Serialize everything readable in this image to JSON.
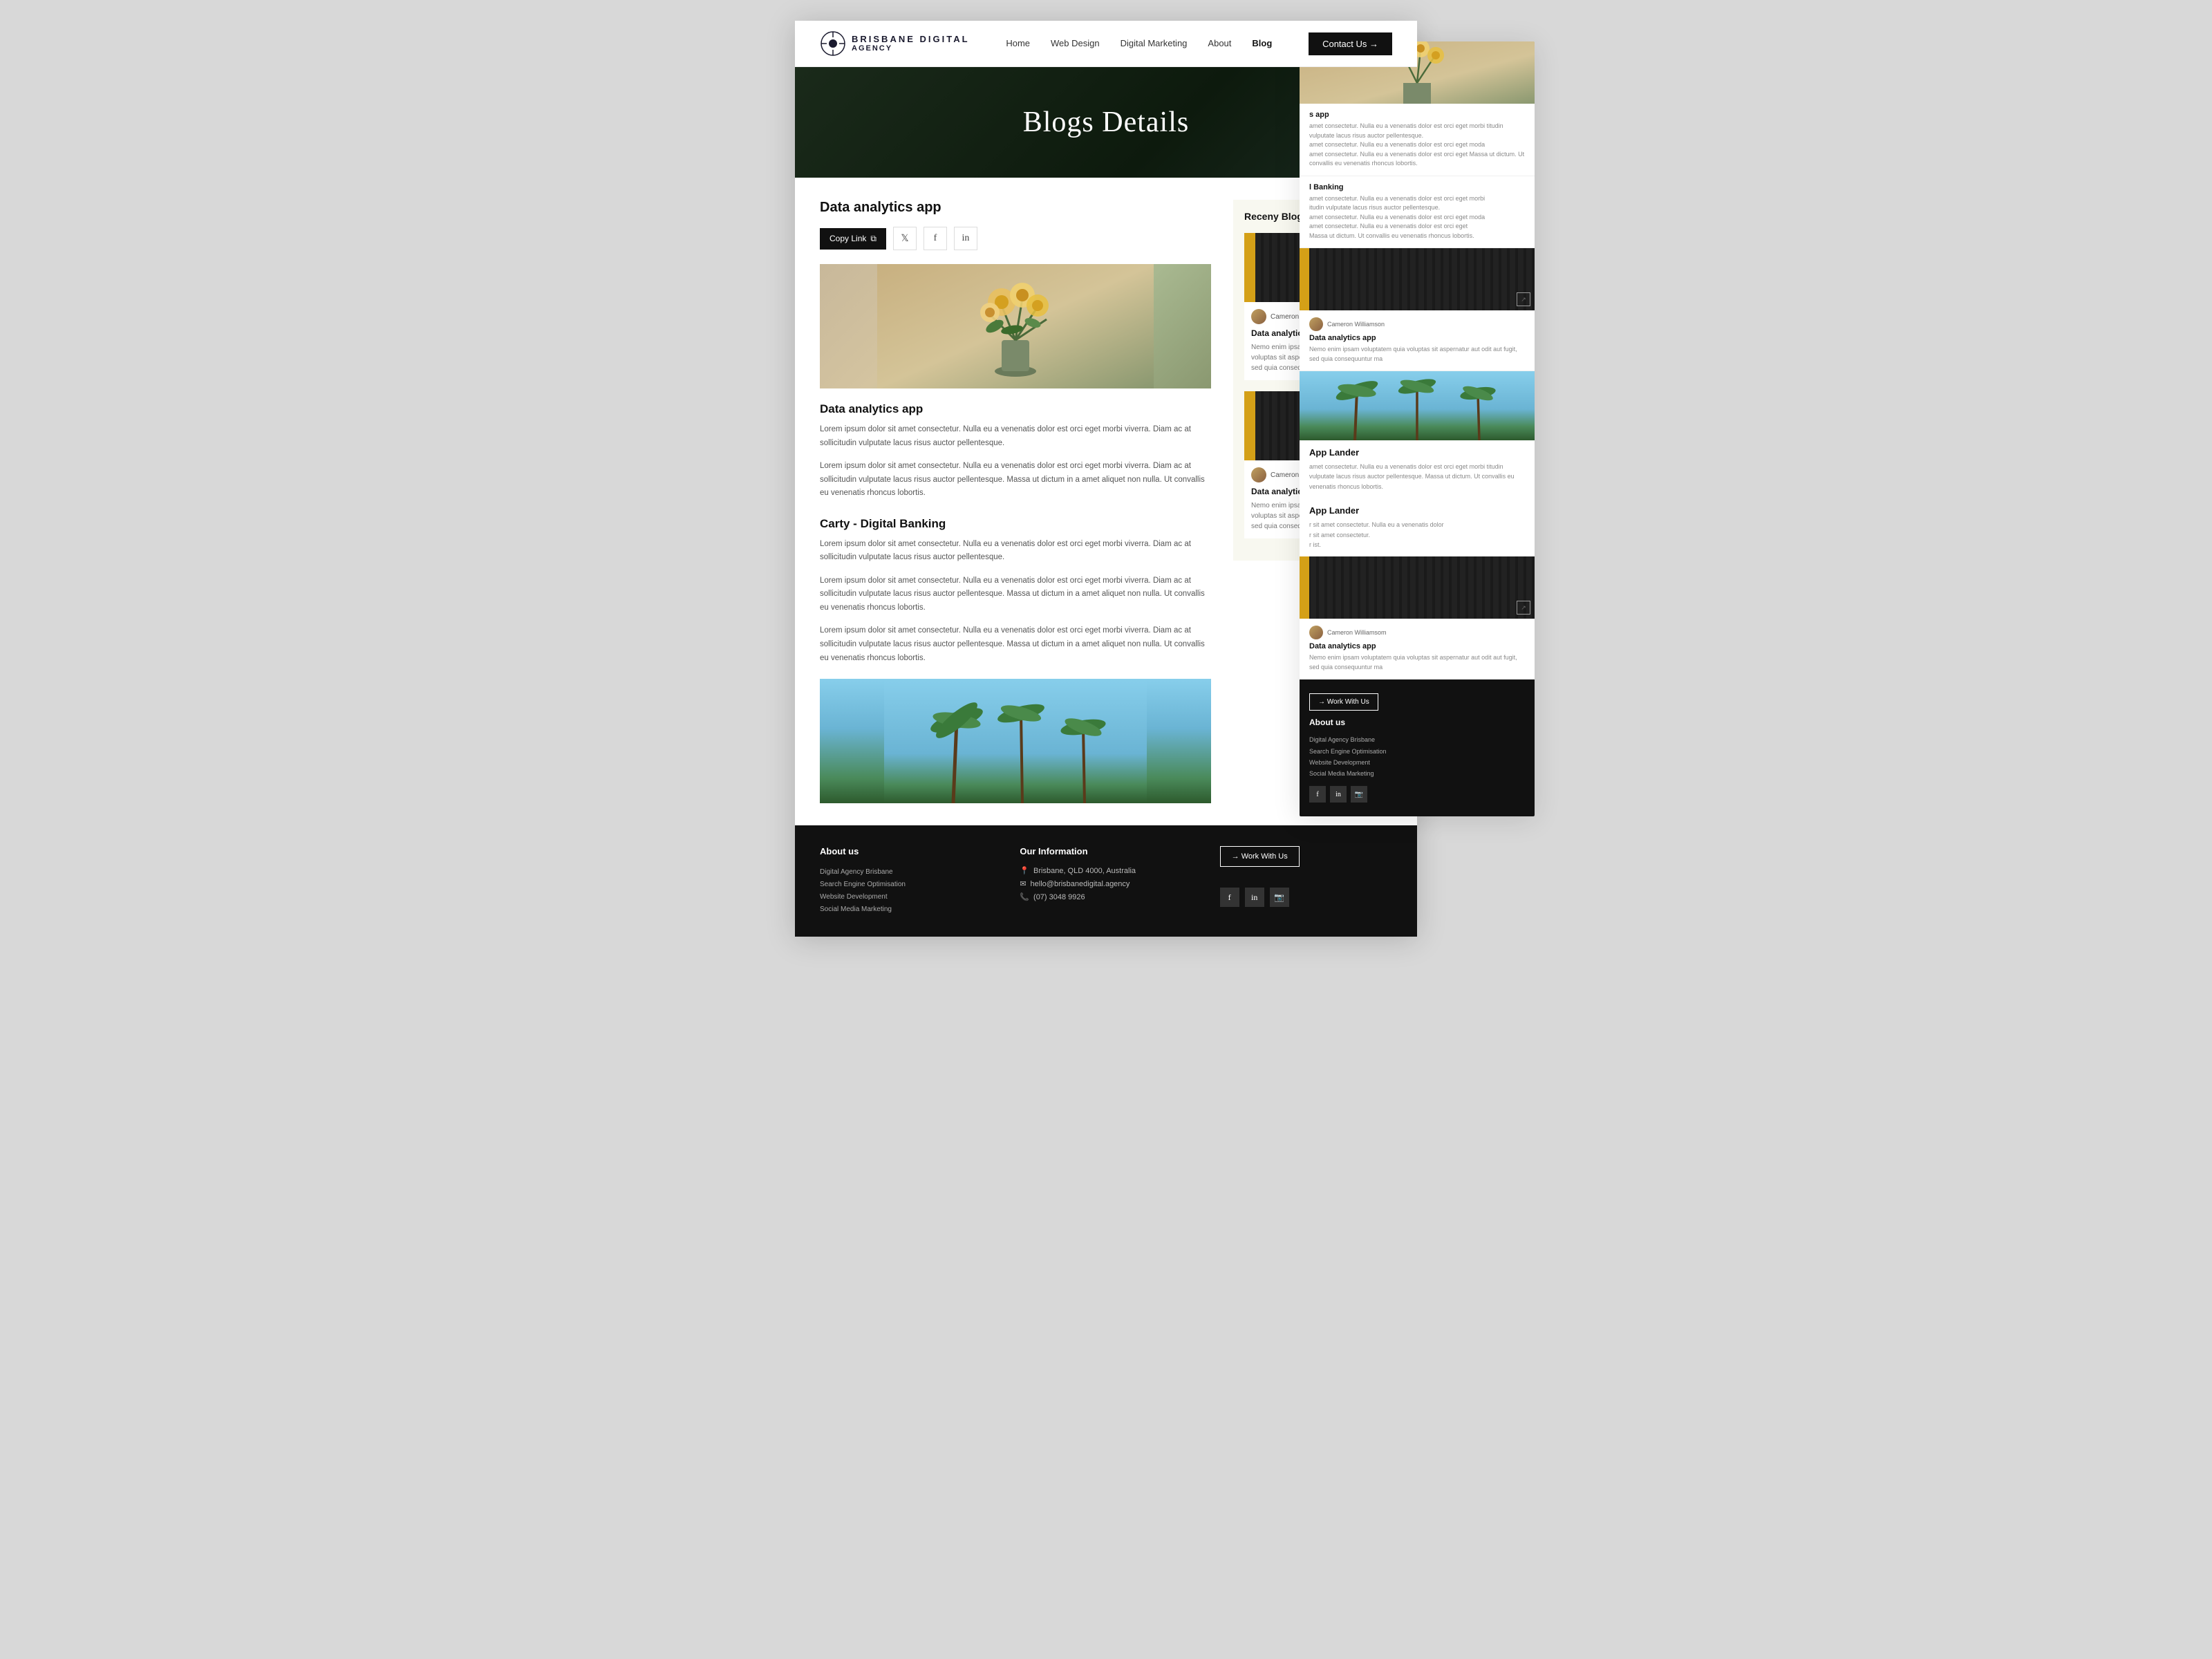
{
  "site": {
    "logo_top": "BRISBANE DIGITAL",
    "logo_bottom": "AGENCY"
  },
  "navbar": {
    "links": [
      {
        "label": "Home",
        "active": false
      },
      {
        "label": "Web Design",
        "active": false
      },
      {
        "label": "Digital Marketing",
        "active": false
      },
      {
        "label": "About",
        "active": false
      },
      {
        "label": "Blog",
        "active": true
      }
    ],
    "contact_btn": "Contact Us →"
  },
  "hero": {
    "title": "Blogs Details"
  },
  "article": {
    "title_main": "Data analytics app",
    "share": {
      "copy_link": "Copy Link"
    },
    "section1_title": "Data analytics app",
    "section1_body1": "Lorem ipsum dolor sit amet consectetur. Nulla eu a venenatis dolor est orci eget morbi viverra. Diam ac at sollicitudin vulputate lacus risus auctor pellentesque.",
    "section1_body2": "Lorem ipsum dolor sit amet consectetur. Nulla eu a venenatis dolor est orci eget morbi viverra. Diam ac at sollicitudin vulputate lacus risus auctor pellentesque. Massa ut dictum in a amet aliquet non nulla. Ut convallis eu venenatis rhoncus lobortis.",
    "section2_title": "Carty - Digital Banking",
    "section2_body1": "Lorem ipsum dolor sit amet consectetur. Nulla eu a venenatis dolor est orci eget morbi viverra. Diam ac at sollicitudin vulputate lacus risus auctor pellentesque.",
    "section2_body2": "Lorem ipsum dolor sit amet consectetur. Nulla eu a venenatis dolor est orci eget morbi viverra. Diam ac at sollicitudin vulputate lacus risus auctor pellentesque. Massa ut dictum in a amet aliquet non nulla. Ut convallis eu venenatis rhoncus lobortis.",
    "section2_body3": "Lorem ipsum dolor sit amet consectetur. Nulla eu a venenatis dolor est orci eget morbi viverra. Diam ac at sollicitudin vulputate lacus risus auctor pellentesque. Massa ut dictum in a amet aliquet non nulla. Ut convallis eu venenatis rhoncus lobortis."
  },
  "sidebar": {
    "recent_blog_title": "Receny Blog",
    "cards": [
      {
        "author": "Cameron Williamson",
        "title": "Data analytics app",
        "excerpt": "Nemo enim ipsam voluptatem quia voluptas sit aspernatur aut odit aut fugit, sed quia consequuntur ma"
      },
      {
        "author": "Cameron Williamson",
        "title": "Data analytics app",
        "excerpt": "Nemo enim ipsam voluptatem quia voluptas sit aspernatur aut odit aut fugit, sed quia consequuntur ma"
      }
    ]
  },
  "right_overflow": {
    "items": [
      {
        "type": "blog_text",
        "label": "s app",
        "excerpt": "amet consectetur. Nulla eu a venenatis dolor est orci eget morbi titudin vulputate lacus risus auctor pellentesque. amet consectetur. Nulla eu a venenatis dolor est orci eget moda amet consectetur. Nulla eu a venenatis dolor est orci eget Massa ut dictum. Ut convallis eu venenatis rhoncus lobortis."
      },
      {
        "type": "blog_text",
        "label": "l Banking",
        "excerpt": "amet consectetur. Nulla eu a venenatis dolor est orci eget morbi itudin vulputate lacus risus auctor pellentesque. amet consectetur. Nulla eu a venenatis dolor est orci eget moda amet consectetur. Nulla eu a venenatis dolor est orci eget Massa ut dictum. Ut convallis eu venenatis rhoncus lobortis."
      },
      {
        "type": "card",
        "author": "Cameron Williamson",
        "title": "Data analytics app",
        "excerpt": "Nemo enim ipsam voluptatem quia voluptas sit aspernatur aut odit aut fugit, sed quia consequuntur ma"
      },
      {
        "type": "trees_section",
        "label": "App Lander",
        "excerpt": "amet consectetur. Nulla eu a venenatis dolor est orci eget morbi itudin vulputate lacus risus auctor pellentesque. Massa ut dictum. Ut convallis eu venenatis rhoncus lobortis."
      },
      {
        "type": "blog_text2",
        "label": "App Lander",
        "excerpt": "r sit amet consectetur. Nulla eu a venenatis dolor r sit amet consectetur. r ist."
      },
      {
        "type": "card2",
        "author": "Cameron Williamsom",
        "title": "Data analytics app",
        "excerpt": "Nemo enim ipsam voluptatem quia voluptas sit aspernatur aut odit aut fugit, sed quia consequuntur ma"
      }
    ]
  },
  "footer": {
    "about_title": "About us",
    "about_text": "Digital Agency Brisbane\nSearch Engine Optimisation\nWebsite Development\nSocial Media Marketing",
    "info_title": "Our Information",
    "info_location": "Brisbane, QLD 4000, Australia",
    "info_email": "hello@brisbanedigital.agency",
    "info_phone": "(07) 3048 9926",
    "work_btn": "→ Work With Us",
    "social_icons": [
      "f",
      "in",
      "📷"
    ]
  }
}
